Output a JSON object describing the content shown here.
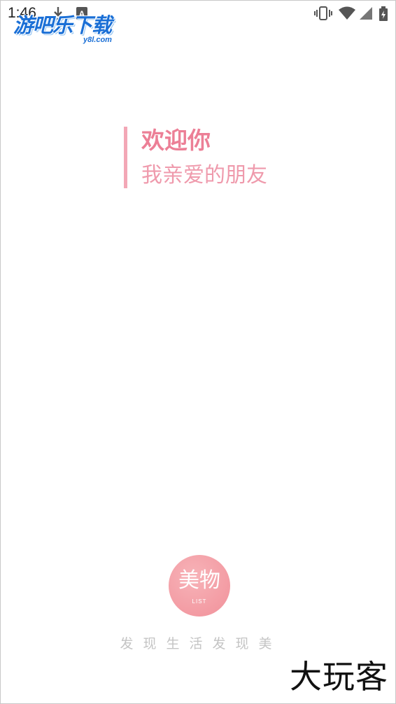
{
  "status_bar": {
    "time": "1:46",
    "icons": [
      "download-icon",
      "text-a-icon",
      "vibrate-icon",
      "wifi-icon",
      "signal-icon",
      "battery-icon"
    ]
  },
  "watermark_top": {
    "title": "游吧乐下载",
    "subtitle": "y8l.com"
  },
  "greeting": {
    "title": "欢迎你",
    "subtitle": "我亲爱的朋友",
    "accent_color": "#f3a7b6",
    "title_color": "#ec7f96"
  },
  "app_badge": {
    "name": "美物",
    "sub": "LIST",
    "color": "#f39ba3"
  },
  "tagline": "发现生活发现美",
  "watermark_bottom": "大玩客"
}
